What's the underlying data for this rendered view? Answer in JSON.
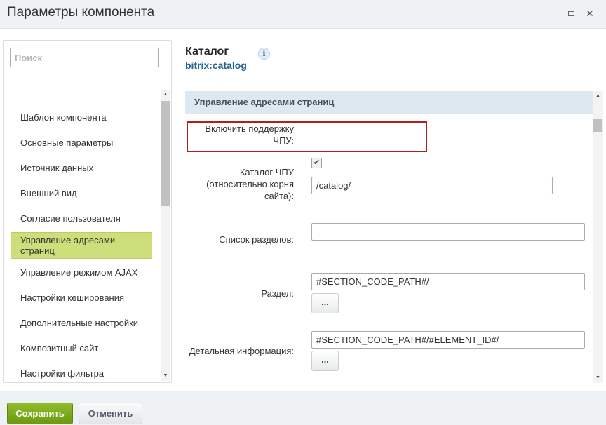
{
  "window": {
    "title": "Параметры компонента",
    "maximize_icon": "maximize-icon",
    "close_icon": "close-icon",
    "close_glyph": "✕"
  },
  "sidebar": {
    "search_placeholder": "Поиск",
    "items": [
      {
        "label": "Шаблон компонента"
      },
      {
        "label": "Основные параметры"
      },
      {
        "label": "Источник данных"
      },
      {
        "label": "Внешний вид"
      },
      {
        "label": "Согласие пользователя"
      },
      {
        "label": "Управление адресами страниц",
        "active": true
      },
      {
        "label": "Управление режимом AJAX"
      },
      {
        "label": "Настройки кеширования"
      },
      {
        "label": "Дополнительные настройки"
      },
      {
        "label": "Композитный сайт"
      },
      {
        "label": "Настройки фильтра"
      }
    ]
  },
  "component": {
    "name": "Каталог",
    "code": "bitrix:catalog",
    "info_glyph": "i"
  },
  "section": {
    "title": "Управление адресами страниц",
    "fields": {
      "sef_enable": {
        "label": "Включить поддержку ЧПУ:",
        "checked": true,
        "glyph": "✔"
      },
      "sef_folder": {
        "label": "Каталог ЧПУ (относительно корня сайта):",
        "value": "/catalog/"
      },
      "sections_list": {
        "label": "Список разделов:",
        "value": ""
      },
      "section": {
        "label": "Раздел:",
        "value": "#SECTION_CODE_PATH#/",
        "button": "..."
      },
      "detail": {
        "label": "Детальная информация:",
        "value": "#SECTION_CODE_PATH#/#ELEMENT_ID#/",
        "button": "..."
      }
    }
  },
  "footer": {
    "save_label": "Сохранить",
    "cancel_label": "Отменить"
  },
  "colors": {
    "accent_green": "#7aab1c",
    "active_item": "#ccdf7a",
    "section_header": "#dde8f1",
    "highlight_border": "#b02020",
    "link_blue": "#27648f"
  }
}
